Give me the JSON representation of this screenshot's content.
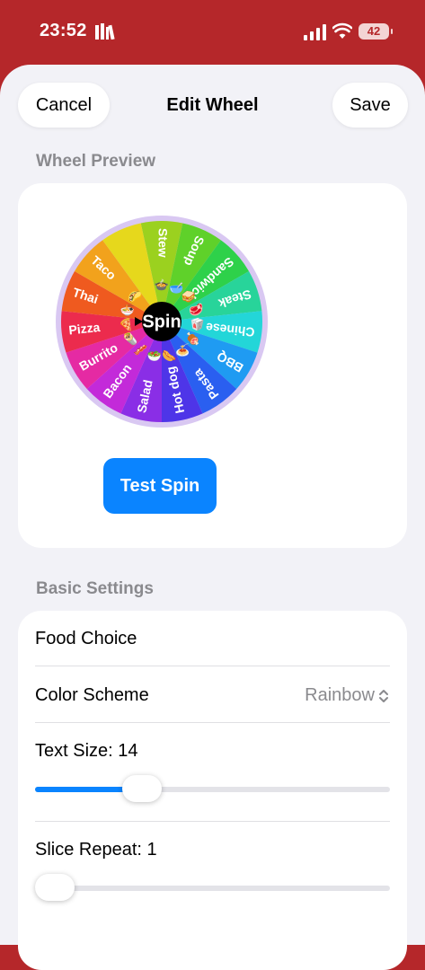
{
  "status": {
    "time": "23:52",
    "battery": "42"
  },
  "nav": {
    "cancel_label": "Cancel",
    "title": "Edit Wheel",
    "save_label": "Save"
  },
  "preview": {
    "section_label": "Wheel Preview",
    "center_label": "Spin",
    "test_spin_label": "Test Spin",
    "slices": [
      {
        "label": "Stew",
        "emoji": "🍲",
        "color": "#9bd11f"
      },
      {
        "label": "Soup",
        "emoji": "🥣",
        "color": "#5fd12a"
      },
      {
        "label": "Sandwich",
        "emoji": "🥪",
        "color": "#2ed14a"
      },
      {
        "label": "Steak",
        "emoji": "🥩",
        "color": "#28d49a"
      },
      {
        "label": "Chinese",
        "emoji": "🥡",
        "color": "#23d6d8"
      },
      {
        "label": "BBQ",
        "emoji": "🍖",
        "color": "#1f9bf2"
      },
      {
        "label": "Pasta",
        "emoji": "🍝",
        "color": "#2a5ff0"
      },
      {
        "label": "Hot dog",
        "emoji": "🌭",
        "color": "#4e35e8"
      },
      {
        "label": "Salad",
        "emoji": "🥗",
        "color": "#8a2ee6"
      },
      {
        "label": "Bacon",
        "emoji": "🥓",
        "color": "#c32ad9"
      },
      {
        "label": "Burrito",
        "emoji": "🌯",
        "color": "#e52aa3"
      },
      {
        "label": "Pizza",
        "emoji": "🍕",
        "color": "#ec2b4d"
      },
      {
        "label": "Thai",
        "emoji": "🍜",
        "color": "#ef5a1f"
      },
      {
        "label": "Taco",
        "emoji": "🌮",
        "color": "#f2a21c"
      },
      {
        "label": "",
        "emoji": "",
        "color": "#e6d81c"
      }
    ]
  },
  "settings": {
    "section_label": "Basic Settings",
    "food_choice": "Food Choice",
    "color_scheme_label": "Color Scheme",
    "color_scheme_value": "Rainbow",
    "text_size_label": "Text Size: 14",
    "text_size_fraction": 0.3,
    "slice_repeat_label": "Slice Repeat: 1",
    "slice_repeat_fraction": 0.0
  }
}
